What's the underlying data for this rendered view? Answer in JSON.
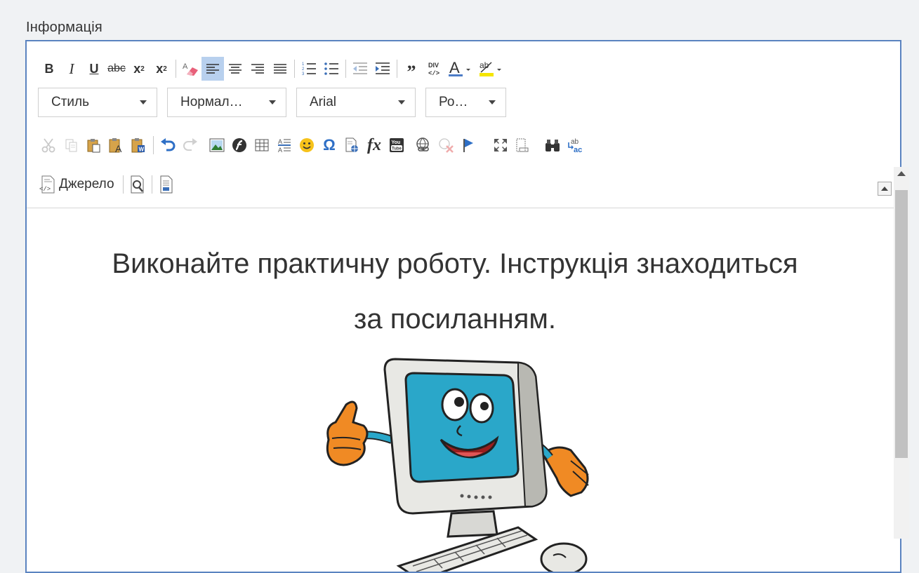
{
  "field": {
    "label": "Інформація"
  },
  "toolbar": {
    "row1": [
      {
        "icon": "bold-icon",
        "glyph": "B"
      },
      {
        "icon": "italic-icon",
        "glyph": "I"
      },
      {
        "icon": "underline-icon",
        "glyph": "U"
      },
      {
        "icon": "strikethrough-icon",
        "glyph": "abc"
      },
      {
        "icon": "subscript-icon",
        "glyph": "x₂"
      },
      {
        "icon": "superscript-icon",
        "glyph": "x²"
      },
      {
        "icon": "remove-format-icon",
        "glyph": ""
      },
      {
        "icon": "align-left-icon",
        "glyph": ""
      },
      {
        "icon": "align-center-icon",
        "glyph": ""
      },
      {
        "icon": "align-right-icon",
        "glyph": ""
      },
      {
        "icon": "align-justify-icon",
        "glyph": ""
      },
      {
        "icon": "numbered-list-icon",
        "glyph": ""
      },
      {
        "icon": "bulleted-list-icon",
        "glyph": ""
      },
      {
        "icon": "outdent-icon",
        "glyph": ""
      },
      {
        "icon": "indent-icon",
        "glyph": ""
      },
      {
        "icon": "blockquote-icon",
        "glyph": "❞"
      },
      {
        "icon": "div-container-icon",
        "glyph": "DIV"
      },
      {
        "icon": "text-color-icon",
        "glyph": "A"
      },
      {
        "icon": "background-color-icon",
        "glyph": "ab"
      }
    ],
    "combos": {
      "style": "Стиль",
      "format": "Нормал…",
      "font": "Arial",
      "size": "Ро…"
    },
    "source_label": "Джерело",
    "colors": {
      "accent": "#5a83c0",
      "active": "#b8d0ee",
      "highlight": "#f5e500",
      "text_color_bar": "#4d7cc6"
    }
  },
  "content": {
    "line1": "Виконайте практичну роботу. Інструкція знаходиться",
    "line2": "за посиланням.",
    "illustration": "cartoon-computer-thumbs-up"
  }
}
